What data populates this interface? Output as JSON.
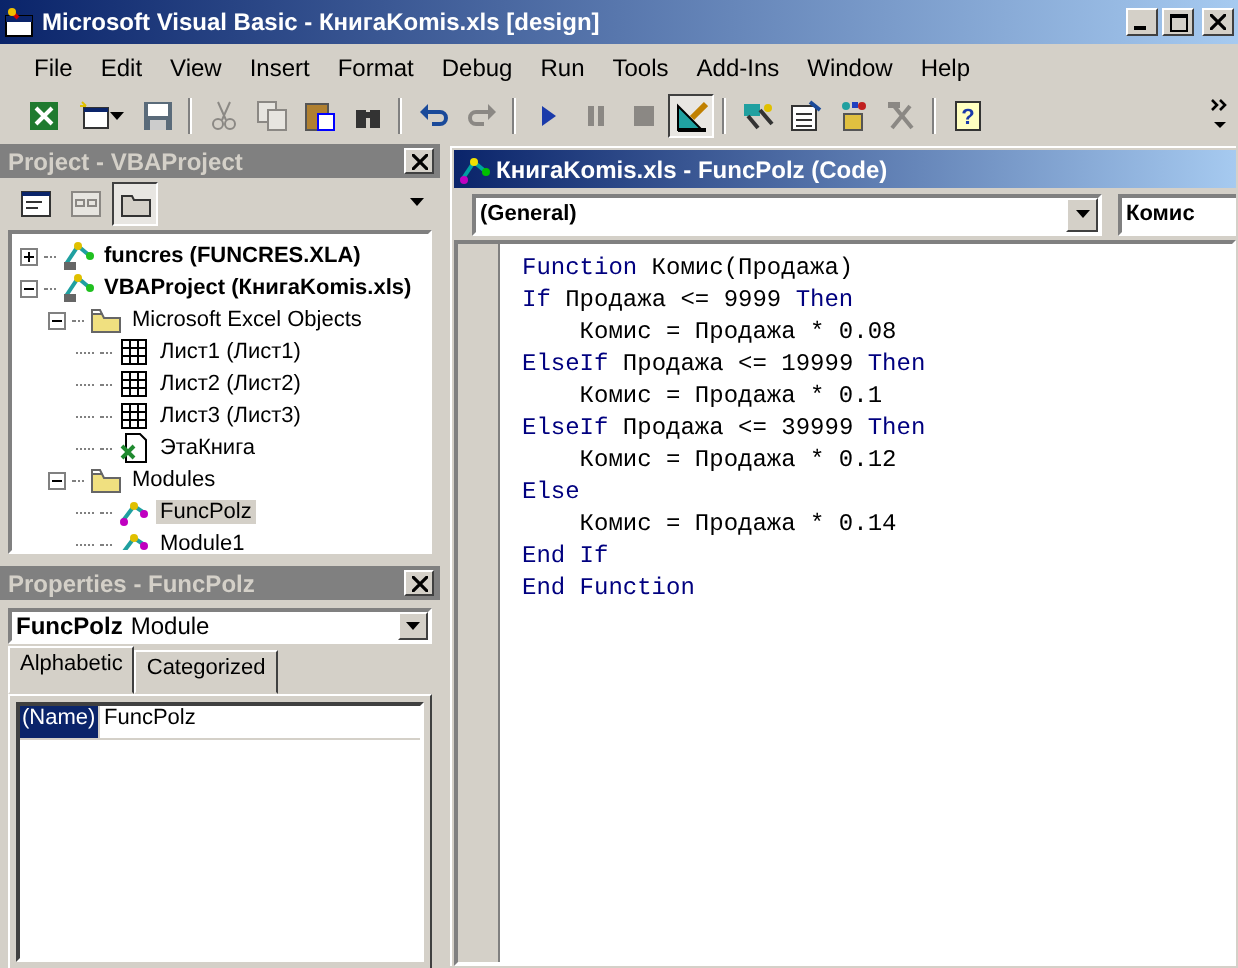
{
  "window": {
    "title": "Microsoft Visual Basic - КнигаKomis.xls [design]"
  },
  "menu": [
    {
      "label": "File"
    },
    {
      "label": "Edit"
    },
    {
      "label": "View"
    },
    {
      "label": "Insert"
    },
    {
      "label": "Format"
    },
    {
      "label": "Debug"
    },
    {
      "label": "Run"
    },
    {
      "label": "Tools"
    },
    {
      "label": "Add-Ins"
    },
    {
      "label": "Window"
    },
    {
      "label": "Help"
    }
  ],
  "toolbar": [
    {
      "kind": "excel",
      "disabled": false,
      "pressed": false
    },
    {
      "kind": "insert",
      "disabled": false,
      "pressed": false
    },
    {
      "kind": "save",
      "disabled": false,
      "pressed": false
    },
    {
      "kind": "sep"
    },
    {
      "kind": "cut",
      "disabled": true,
      "pressed": false
    },
    {
      "kind": "copy",
      "disabled": true,
      "pressed": false
    },
    {
      "kind": "paste",
      "disabled": false,
      "pressed": false
    },
    {
      "kind": "find",
      "disabled": false,
      "pressed": false
    },
    {
      "kind": "sep"
    },
    {
      "kind": "undo",
      "disabled": false,
      "pressed": false
    },
    {
      "kind": "redo",
      "disabled": true,
      "pressed": false
    },
    {
      "kind": "sep"
    },
    {
      "kind": "run",
      "disabled": false,
      "pressed": false
    },
    {
      "kind": "pause",
      "disabled": true,
      "pressed": false
    },
    {
      "kind": "stop",
      "disabled": true,
      "pressed": false
    },
    {
      "kind": "design",
      "disabled": false,
      "pressed": true
    },
    {
      "kind": "sep"
    },
    {
      "kind": "explorer",
      "disabled": false,
      "pressed": false
    },
    {
      "kind": "properties",
      "disabled": false,
      "pressed": false
    },
    {
      "kind": "browser",
      "disabled": false,
      "pressed": false
    },
    {
      "kind": "tools",
      "disabled": true,
      "pressed": false
    },
    {
      "kind": "sep"
    },
    {
      "kind": "help",
      "glyph": "?",
      "disabled": false,
      "pressed": false
    }
  ],
  "project": {
    "title": "Project - VBAProject",
    "toolbar": [
      {
        "kind": "view_code",
        "disabled": false,
        "pressed": false
      },
      {
        "kind": "view_object",
        "disabled": true,
        "pressed": false
      },
      {
        "kind": "folders",
        "disabled": false,
        "pressed": true
      }
    ],
    "tree": [
      {
        "label": "funcres (FUNCRES.XLA)",
        "kind": "project",
        "expanded": false,
        "selected": false
      },
      {
        "label": "VBAProject (КнигаKomis.xls)",
        "kind": "project",
        "expanded": true,
        "selected": false,
        "children": [
          {
            "label": "Microsoft Excel Objects",
            "kind": "folder",
            "expanded": true,
            "selected": false,
            "children": [
              {
                "label": "Лист1 (Лист1)",
                "kind": "sheet",
                "selected": false
              },
              {
                "label": "Лист2 (Лист2)",
                "kind": "sheet",
                "selected": false
              },
              {
                "label": "Лист3 (Лист3)",
                "kind": "sheet",
                "selected": false
              },
              {
                "label": "ЭтаКнига",
                "kind": "workbook",
                "selected": false
              }
            ]
          },
          {
            "label": "Modules",
            "kind": "folder",
            "expanded": true,
            "selected": false,
            "children": [
              {
                "label": "FuncPolz",
                "kind": "module",
                "selected": true
              },
              {
                "label": "Module1",
                "kind": "module",
                "selected": false
              }
            ]
          }
        ]
      }
    ]
  },
  "properties": {
    "title": "Properties - FuncPolz",
    "object_name": "FuncPolz",
    "object_type": "Module",
    "tabs": [
      {
        "label": "Alphabetic",
        "selected": true
      },
      {
        "label": "Categorized",
        "selected": false
      }
    ],
    "rows": [
      {
        "name": "(Name)",
        "value": "FuncPolz",
        "selected": true
      }
    ]
  },
  "code_window": {
    "title": "КнигаKomis.xls - FuncPolz (Code)",
    "object_combo": "(General)",
    "procedure_combo": "Комис",
    "lines": [
      [
        {
          "text": "Function",
          "kind": "keyword"
        },
        {
          "text": " Комис(Продажа)",
          "kind": "plain"
        }
      ],
      [
        {
          "text": "If",
          "kind": "keyword"
        },
        {
          "text": " Продажа <= 9999 ",
          "kind": "plain"
        },
        {
          "text": "Then",
          "kind": "keyword"
        }
      ],
      [
        {
          "text": "    Комис = Продажа * 0.08",
          "kind": "plain"
        }
      ],
      [
        {
          "text": "ElseIf",
          "kind": "keyword"
        },
        {
          "text": " Продажа <= 19999 ",
          "kind": "plain"
        },
        {
          "text": "Then",
          "kind": "keyword"
        }
      ],
      [
        {
          "text": "    Комис = Продажа * 0.1",
          "kind": "plain"
        }
      ],
      [
        {
          "text": "ElseIf",
          "kind": "keyword"
        },
        {
          "text": " Продажа <= 39999 ",
          "kind": "plain"
        },
        {
          "text": "Then",
          "kind": "keyword"
        }
      ],
      [
        {
          "text": "    Комис = Продажа * 0.12",
          "kind": "plain"
        }
      ],
      [
        {
          "text": "Else",
          "kind": "keyword"
        }
      ],
      [
        {
          "text": "    Комис = Продажа * 0.14",
          "kind": "plain"
        }
      ],
      [
        {
          "text": "End If",
          "kind": "keyword"
        }
      ],
      [
        {
          "text": "End Function",
          "kind": "keyword"
        }
      ]
    ]
  }
}
